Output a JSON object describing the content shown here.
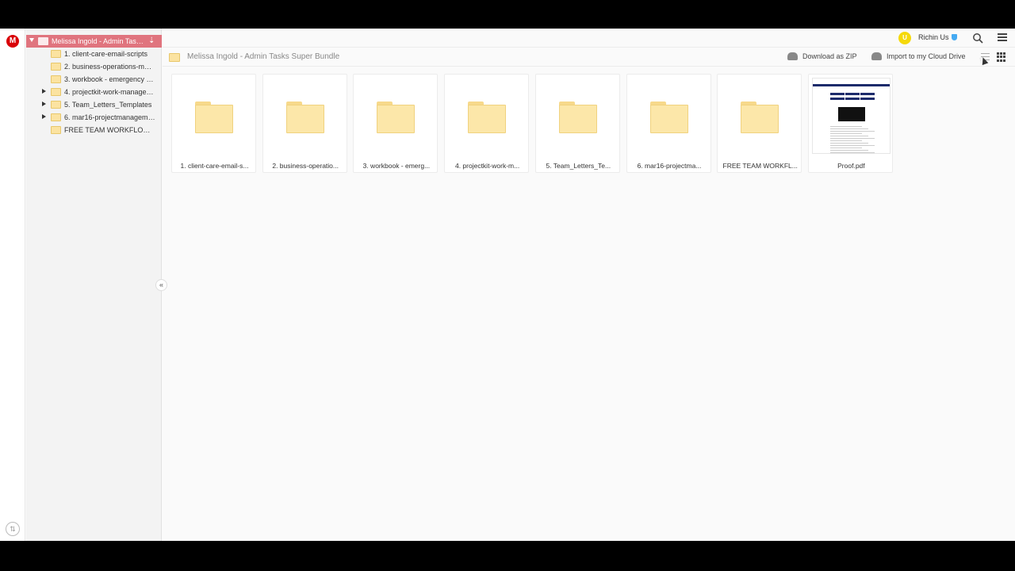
{
  "rail": {
    "logo_letter": "M"
  },
  "tree": {
    "root_label": "Melissa Ingold - Admin Tasks Super Bundle",
    "items": [
      {
        "label": "1. client-care-email-scripts",
        "expandable": false
      },
      {
        "label": "2. business-operations-management",
        "expandable": false
      },
      {
        "label": "3. workbook - emergency d...",
        "expandable": false
      },
      {
        "label": "4. projectkit-work-management",
        "expandable": true
      },
      {
        "label": "5. Team_Letters_Templates",
        "expandable": true
      },
      {
        "label": "6. mar16-projectmanagement",
        "expandable": true
      },
      {
        "label": "FREE TEAM WORKFLOWS T...",
        "expandable": false
      }
    ]
  },
  "topbar": {
    "avatar_initial": "U",
    "user_name": "Richin Us"
  },
  "breadcrumb": {
    "path": "Melissa Ingold - Admin Tasks Super Bundle"
  },
  "actions": {
    "download_zip": "Download as ZIP",
    "import_cloud": "Import to my Cloud Drive"
  },
  "files": [
    {
      "name": "1. client-care-email-s...",
      "type": "folder"
    },
    {
      "name": "2. business-operatio...",
      "type": "folder"
    },
    {
      "name": "3. workbook - emerg...",
      "type": "folder"
    },
    {
      "name": "4. projectkit-work-m...",
      "type": "folder"
    },
    {
      "name": "5. Team_Letters_Te...",
      "type": "folder"
    },
    {
      "name": "6. mar16-projectma...",
      "type": "folder"
    },
    {
      "name": "FREE TEAM WORKFL...",
      "type": "folder"
    },
    {
      "name": "Proof.pdf",
      "type": "pdf"
    }
  ],
  "colors": {
    "root_highlight": "#e0747e",
    "folder_fill": "#fce7a9",
    "logo_red": "#d90007"
  }
}
